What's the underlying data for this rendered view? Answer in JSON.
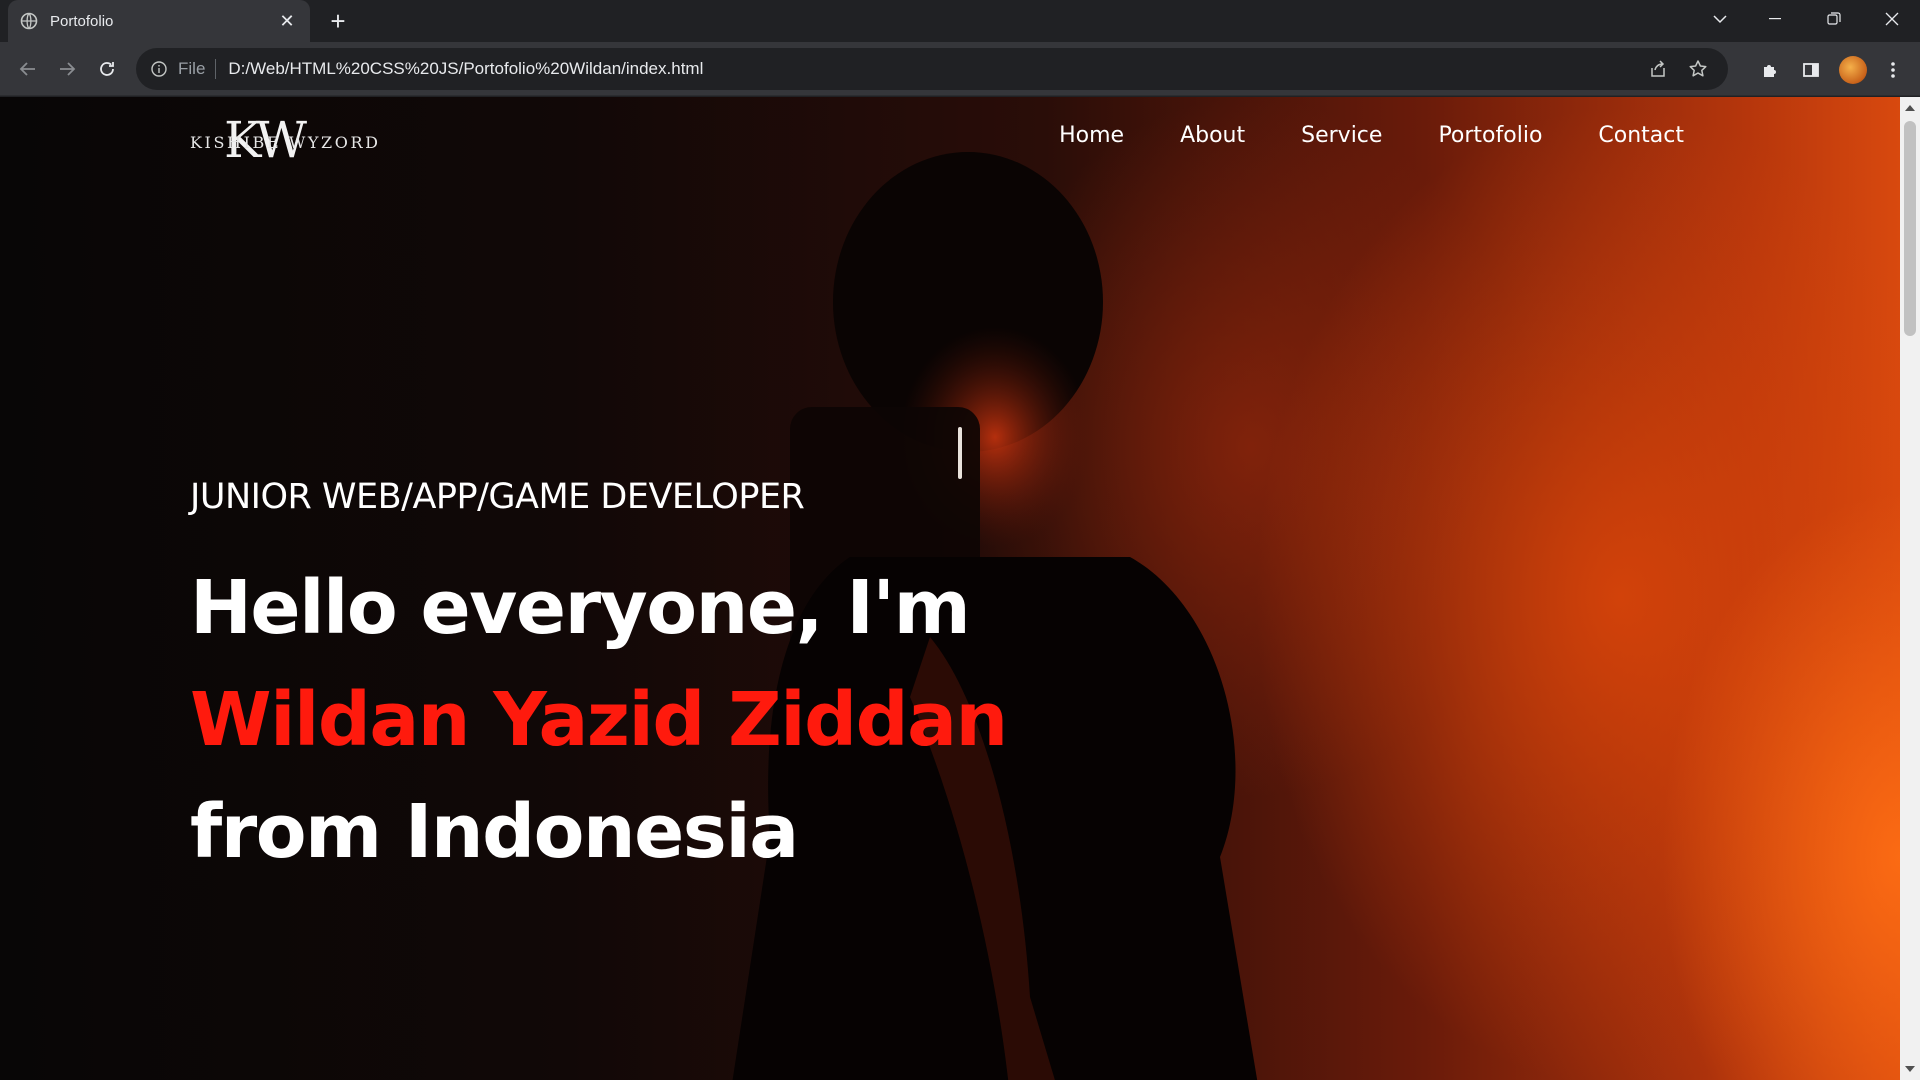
{
  "browser": {
    "tab": {
      "title": "Portofolio",
      "favicon": "globe-icon"
    },
    "address": {
      "scheme_label": "File",
      "url": "D:/Web/HTML%20CSS%20JS/Portofolio%20Wildan/index.html"
    }
  },
  "site": {
    "logo": {
      "monogram": "KW",
      "brand": "KISHIBE WYZORD"
    },
    "nav": [
      "Home",
      "About",
      "Service",
      "Portofolio",
      "Contact"
    ],
    "hero": {
      "subtitle": "JUNIOR WEB/APP/GAME DEVELOPER",
      "line1": "Hello everyone, I'm",
      "line2": "Wildan Yazid Ziddan",
      "line3": "from Indonesia"
    }
  },
  "colors": {
    "accent_name": "#ff1a0d",
    "chrome_dark": "#202124",
    "chrome_toolbar": "#35363a"
  }
}
